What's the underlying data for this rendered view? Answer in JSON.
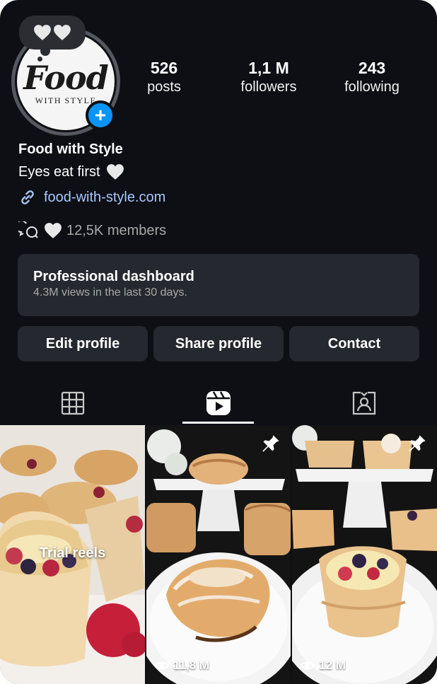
{
  "profile": {
    "logo_script": "Food",
    "logo_sub": "WITH STYLE",
    "display_name": "Food with Style",
    "bio": "Eyes eat first",
    "website": "food-with-style.com",
    "members": "12,5K members"
  },
  "stats": [
    {
      "value": "526",
      "label": "posts"
    },
    {
      "value": "1,1 M",
      "label": "followers"
    },
    {
      "value": "243",
      "label": "following"
    }
  ],
  "dashboard": {
    "title": "Professional dashboard",
    "subtitle": "4.3M views in the last 30 days."
  },
  "buttons": {
    "edit": "Edit profile",
    "share": "Share profile",
    "contact": "Contact"
  },
  "tabs": [
    {
      "icon": "grid-icon",
      "active": false
    },
    {
      "icon": "reels-icon",
      "active": true
    },
    {
      "icon": "tagged-icon",
      "active": false
    }
  ],
  "grid": [
    {
      "overlay": "Trial reels",
      "views": ""
    },
    {
      "overlay": "",
      "views": "11,8 M",
      "pinned": true
    },
    {
      "overlay": "",
      "views": "12 M",
      "pinned": true
    }
  ],
  "colors": {
    "background": "#0d0f14",
    "surface": "#25282e",
    "accent": "#0a95f6",
    "link": "#a8c7fa",
    "muted": "#a8a8a8"
  }
}
